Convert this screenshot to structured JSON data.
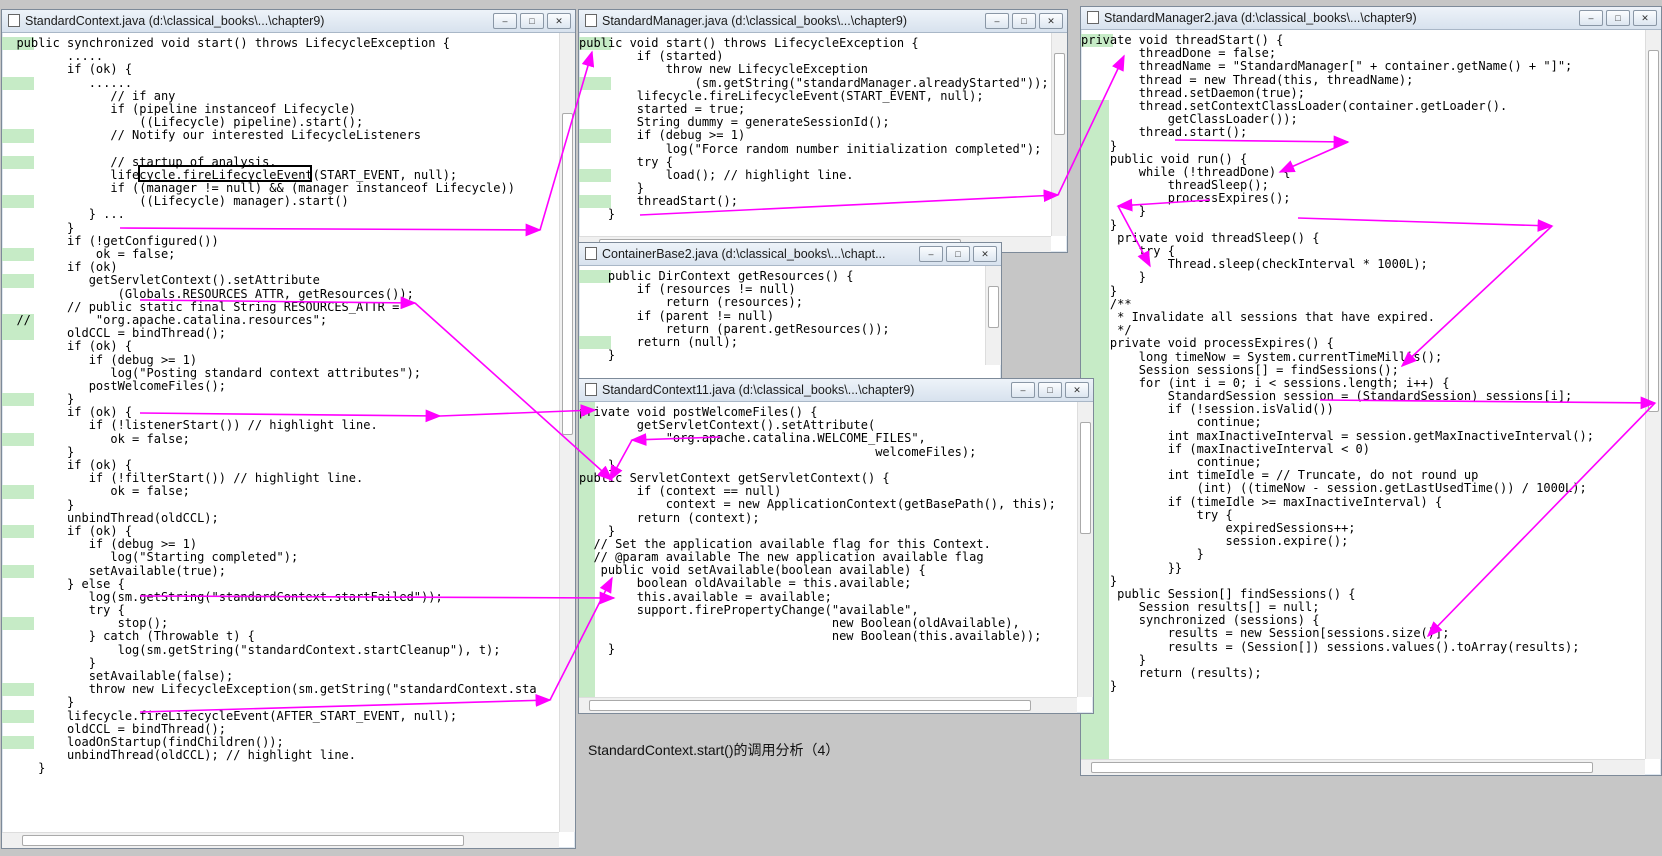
{
  "caption": "StandardContext.start()的调用分析（4）",
  "windows": [
    {
      "id": "w1",
      "title": "StandardContext.java (d:\\classical_books\\...\\chapter9)",
      "lines": [
        "  public synchronized void start() throws LifecycleException {",
        "         .....",
        "         if (ok) {",
        "            ......",
        "               // if any",
        "               if (pipeline instanceof Lifecycle)",
        "                   ((Lifecycle) pipeline).start();",
        "               // Notify our interested LifecycleListeners",
        "",
        "               // startup of analysis.",
        "               lifecycle.fireLifecycleEvent(START_EVENT, null);",
        "               if ((manager != null) && (manager instanceof Lifecycle))",
        "                   ((Lifecycle) manager).start()",
        "            } ...",
        "         }",
        "         if (!getConfigured())",
        "             ok = false;",
        "         if (ok)",
        "            getServletContext().setAttribute",
        "                (Globals.RESOURCES_ATTR, getResources());",
        "         // public static final String RESOURCES_ATTR =",
        "  //         \"org.apache.catalina.resources\";",
        "         oldCCL = bindThread();",
        "         if (ok) {",
        "            if (debug >= 1)",
        "               log(\"Posting standard context attributes\");",
        "            postWelcomeFiles();",
        "         }",
        "         if (ok) {",
        "            if (!listenerStart()) // highlight line.",
        "               ok = false;",
        "         }",
        "         if (ok) {",
        "            if (!filterStart()) // highlight line.",
        "               ok = false;",
        "         }",
        "         unbindThread(oldCCL);",
        "         if (ok) {",
        "            if (debug >= 1)",
        "               log(\"Starting completed\");",
        "            setAvailable(true);",
        "         } else {",
        "            log(sm.getString(\"standardContext.startFailed\"));",
        "            try {",
        "                stop();",
        "            } catch (Throwable t) {",
        "                log(sm.getString(\"standardContext.startCleanup\"), t);",
        "            }",
        "            setAvailable(false);",
        "            throw new LifecycleException(sm.getString(\"standardContext.sta",
        "         }",
        "         lifecycle.fireLifecycleEvent(AFTER_START_EVENT, null);",
        "         oldCCL = bindThread();",
        "         loadOnStartup(findChildren());",
        "         unbindThread(oldCCL); // highlight line.",
        "     }"
      ]
    },
    {
      "id": "w2",
      "title": "StandardManager.java (d:\\classical_books\\...\\chapter9)",
      "lines": [
        "public void start() throws LifecycleException {",
        "        if (started)",
        "            throw new LifecycleException",
        "                (sm.getString(\"standardManager.alreadyStarted\"));",
        "        lifecycle.fireLifecycleEvent(START_EVENT, null);",
        "        started = true;",
        "        String dummy = generateSessionId();",
        "        if (debug >= 1)",
        "            log(\"Force random number initialization completed\");",
        "        try {",
        "            load(); // highlight line.",
        "        }",
        "        threadStart();",
        "    }"
      ]
    },
    {
      "id": "w3",
      "title": "StandardManager2.java (d:\\classical_books\\...\\chapter9)",
      "lines": [
        "private void threadStart() {",
        "        threadDone = false;",
        "        threadName = \"StandardManager[\" + container.getName() + \"]\";",
        "        thread = new Thread(this, threadName);",
        "        thread.setDaemon(true);",
        "        thread.setContextClassLoader(container.getLoader().",
        "            getClassLoader());",
        "        thread.start();",
        "    }",
        "    public void run() {",
        "        while (!threadDone) {",
        "            threadSleep();",
        "            processExpires();",
        "        }",
        "    }",
        "     private void threadSleep() {",
        "        try {",
        "            Thread.sleep(checkInterval * 1000L);",
        "        }",
        "    }",
        "    /**",
        "     * Invalidate all sessions that have expired.",
        "     */",
        "    private void processExpires() {",
        "        long timeNow = System.currentTimeMillis();",
        "        Session sessions[] = findSessions();",
        "        for (int i = 0; i < sessions.length; i++) {",
        "            StandardSession session = (StandardSession) sessions[i];",
        "            if (!session.isValid())",
        "                continue;",
        "            int maxInactiveInterval = session.getMaxInactiveInterval();",
        "            if (maxInactiveInterval < 0)",
        "                continue;",
        "            int timeIdle = // Truncate, do not round up",
        "                (int) ((timeNow - session.getLastUsedTime()) / 1000L);",
        "            if (timeIdle >= maxInactiveInterval) {",
        "                try {",
        "                    expiredSessions++;",
        "                    session.expire();",
        "                }",
        "            }}",
        "    }",
        "     public Session[] findSessions() {",
        "        Session results[] = null;",
        "        synchronized (sessions) {",
        "            results = new Session[sessions.size()];",
        "            results = (Session[]) sessions.values().toArray(results);",
        "        }",
        "        return (results);",
        "    }"
      ]
    },
    {
      "id": "w4",
      "title": "ContainerBase2.java (d:\\classical_books\\...\\chapt...",
      "lines": [
        "    public DirContext getResources() {",
        "        if (resources != null)",
        "            return (resources);",
        "        if (parent != null)",
        "            return (parent.getResources());",
        "        return (null);",
        "    }"
      ]
    },
    {
      "id": "w5",
      "title": "StandardContext11.java (d:\\classical_books\\...\\chapter9)",
      "lines": [
        "private void postWelcomeFiles() {",
        "        getServletContext().setAttribute(",
        "            \"org.apache.catalina.WELCOME_FILES\",",
        "                                         welcomeFiles);",
        "    }",
        "public ServletContext getServletContext() {",
        "        if (context == null)",
        "            context = new ApplicationContext(getBasePath(), this);",
        "        return (context);",
        "    }",
        "  // Set the application available flag for this Context.",
        "  // @param available The new application available flag",
        "   public void setAvailable(boolean available) {",
        "        boolean oldAvailable = this.available;",
        "        this.available = available;",
        "        support.firePropertyChange(\"available\",",
        "                                   new Boolean(oldAvailable),",
        "                                   new Boolean(this.available));",
        "    }"
      ]
    }
  ]
}
